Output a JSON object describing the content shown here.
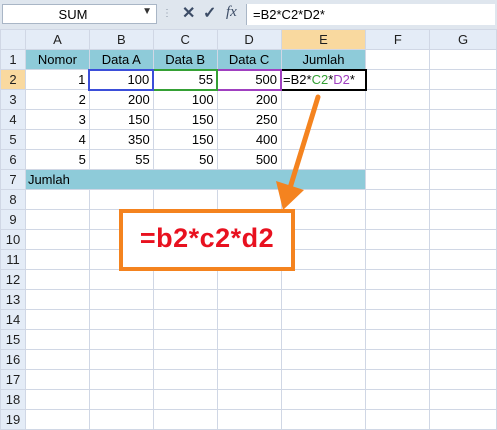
{
  "formula_bar": {
    "name_box": "SUM",
    "cancel_icon": "✕",
    "enter_icon": "✓",
    "fx_label": "fx",
    "formula": "=B2*C2*D2*"
  },
  "columns": [
    "A",
    "B",
    "C",
    "D",
    "E",
    "F",
    "G"
  ],
  "rows": [
    "1",
    "2",
    "3",
    "4",
    "5",
    "6",
    "7",
    "8",
    "9",
    "10",
    "11",
    "12",
    "13",
    "14",
    "15",
    "16",
    "17",
    "18",
    "19"
  ],
  "table": {
    "headers": [
      "Nomor",
      "Data A",
      "Data B",
      "Data C",
      "Jumlah"
    ],
    "data": [
      [
        "1",
        "100",
        "55",
        "500"
      ],
      [
        "2",
        "200",
        "100",
        "200"
      ],
      [
        "3",
        "150",
        "150",
        "250"
      ],
      [
        "4",
        "350",
        "150",
        "400"
      ],
      [
        "5",
        "55",
        "50",
        "500"
      ]
    ],
    "total_label": "Jumlah",
    "active_cell": {
      "p1": "=B2",
      "s1": "*",
      "p2": "C2",
      "s2": "*",
      "p3": "D2",
      "s3": "*"
    }
  },
  "annotation": {
    "callout_text": "=b2*c2*d2",
    "color": "#f4831f",
    "text_color": "#e8111f"
  }
}
